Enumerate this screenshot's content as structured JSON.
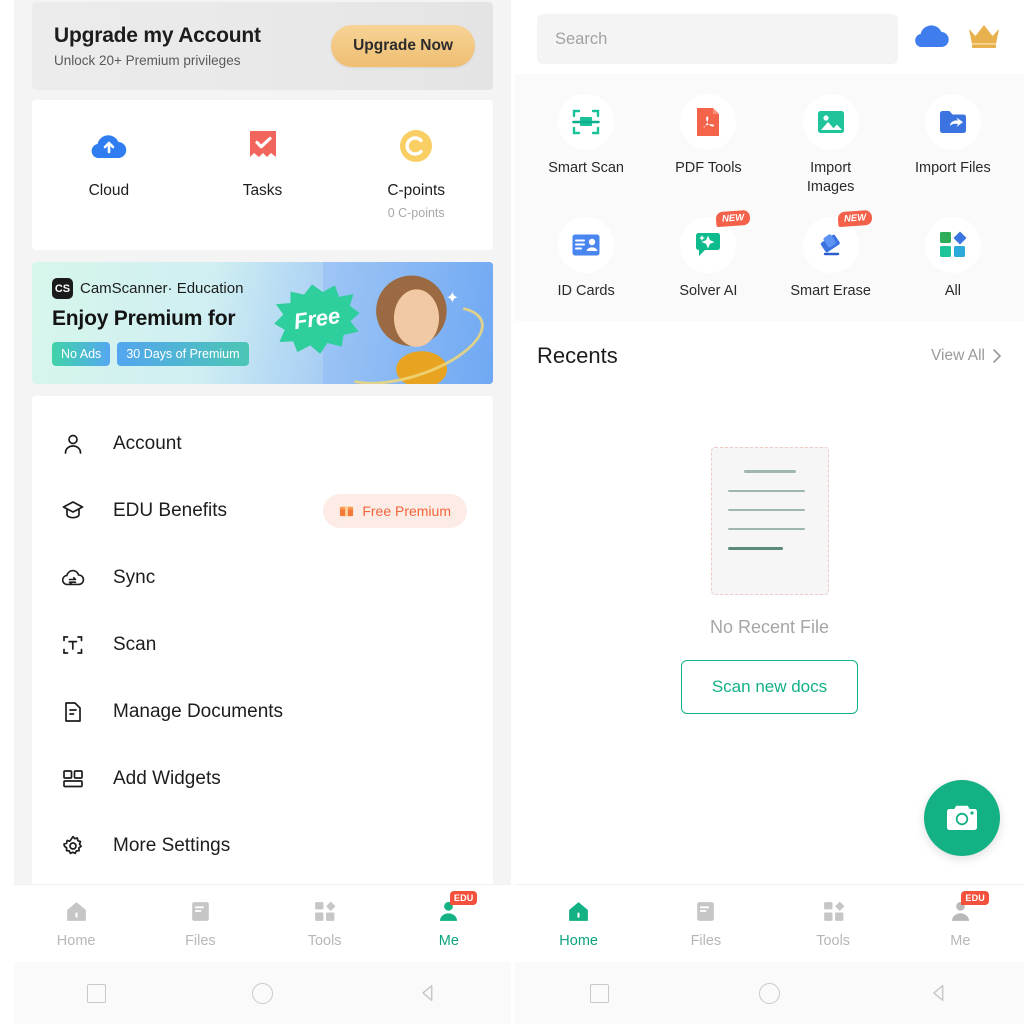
{
  "left_screen": {
    "upgrade": {
      "title": "Upgrade my Account",
      "subtitle": "Unlock 20+ Premium privileges",
      "button": "Upgrade Now"
    },
    "quick_actions": [
      {
        "label": "Cloud",
        "sub": "",
        "icon": "cloud-upload-icon",
        "color": "#2f7df0"
      },
      {
        "label": "Tasks",
        "sub": "",
        "icon": "task-check-icon",
        "color": "#f2655c"
      },
      {
        "label": "C-points",
        "sub": "0 C-points",
        "icon": "c-coin-icon",
        "color": "#f7c948"
      }
    ],
    "promo": {
      "logo": "CS",
      "brand": "CamScanner·  Education",
      "headline": "Enjoy Premium for",
      "burst": "Free",
      "tags": [
        "No Ads",
        "30 Days of Premium"
      ]
    },
    "menu": [
      {
        "label": "Account",
        "icon": "person-icon",
        "badge": ""
      },
      {
        "label": "EDU Benefits",
        "icon": "graduation-cap-icon",
        "badge": "Free Premium",
        "badge_icon": "gift-icon"
      },
      {
        "label": "Sync",
        "icon": "sync-cloud-icon",
        "badge": ""
      },
      {
        "label": "Scan",
        "icon": "scan-text-icon",
        "badge": ""
      },
      {
        "label": "Manage Documents",
        "icon": "document-icon",
        "badge": ""
      },
      {
        "label": "Add Widgets",
        "icon": "widgets-icon",
        "badge": ""
      },
      {
        "label": "More Settings",
        "icon": "gear-icon",
        "badge": ""
      }
    ],
    "tabs": [
      {
        "label": "Home",
        "icon": "home-icon",
        "active": false,
        "badge": ""
      },
      {
        "label": "Files",
        "icon": "files-icon",
        "active": false,
        "badge": ""
      },
      {
        "label": "Tools",
        "icon": "tools-icon",
        "active": false,
        "badge": ""
      },
      {
        "label": "Me",
        "icon": "person-icon",
        "active": true,
        "badge": "EDU"
      }
    ]
  },
  "right_screen": {
    "search": {
      "placeholder": "Search",
      "value": ""
    },
    "header_icons": [
      {
        "name": "cloud-icon",
        "color": "#3f7ced"
      },
      {
        "name": "crown-icon",
        "color": "#e8b14e"
      }
    ],
    "tools": [
      {
        "label": "Smart Scan",
        "icon": "smart-scan-icon",
        "badge": ""
      },
      {
        "label": "PDF Tools",
        "icon": "pdf-file-icon",
        "badge": ""
      },
      {
        "label": "Import\nImages",
        "icon": "image-import-icon",
        "badge": ""
      },
      {
        "label": "Import Files",
        "icon": "folder-import-icon",
        "badge": ""
      },
      {
        "label": "ID Cards",
        "icon": "id-card-icon",
        "badge": ""
      },
      {
        "label": "Solver AI",
        "icon": "ai-sparkle-icon",
        "badge": "NEW"
      },
      {
        "label": "Smart Erase",
        "icon": "eraser-icon",
        "badge": "NEW"
      },
      {
        "label": "All",
        "icon": "grid-all-icon",
        "badge": ""
      }
    ],
    "recents": {
      "title": "Recents",
      "view_all": "View All",
      "empty_text": "No Recent File",
      "scan_button": "Scan new docs"
    },
    "fab": {
      "icon": "camera-icon",
      "color": "#13b184"
    },
    "tabs": [
      {
        "label": "Home",
        "icon": "home-icon",
        "active": true,
        "badge": ""
      },
      {
        "label": "Files",
        "icon": "files-icon",
        "active": false,
        "badge": ""
      },
      {
        "label": "Tools",
        "icon": "tools-icon",
        "active": false,
        "badge": ""
      },
      {
        "label": "Me",
        "icon": "person-icon",
        "active": false,
        "badge": "EDU"
      }
    ]
  },
  "colors": {
    "accent": "#13b184",
    "premium": "#f3643a",
    "badge_new": "#f4614a",
    "inactive": "#b7b7b7"
  }
}
